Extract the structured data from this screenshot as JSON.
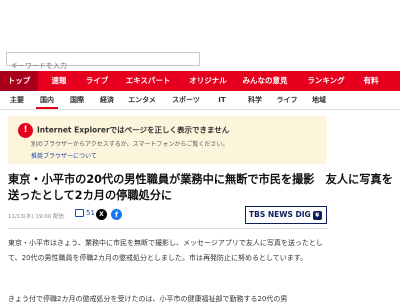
{
  "search": {
    "placeholder": "キーワードを入力"
  },
  "nav": {
    "items": [
      "トップ",
      "速報",
      "ライブ",
      "エキスパート",
      "オリジナル",
      "みんなの意見",
      "ランキング",
      "有料"
    ],
    "active": "トップ"
  },
  "subnav": {
    "items": [
      "主要",
      "国内",
      "国際",
      "経済",
      "エンタメ",
      "スポーツ",
      "IT",
      "科学",
      "ライフ",
      "地域"
    ],
    "active": "国内"
  },
  "notice": {
    "title": "Internet Explorerではページを正しく表示できません",
    "line1": "別のブラウザーからアクセスするか、スマートフォンからご覧ください。",
    "link": "推奨ブラウザーについて"
  },
  "article": {
    "headline": "東京・小平市の20代の男性職員が業務中に無断で市民を撮影　友人に写真を送ったとして2カ月の停職処分に",
    "date": "11/13(木) 19:00 配信",
    "comment_count": "51",
    "source_logo": "TBS NEWS DIG",
    "paragraph1": "東京・小平市はきょう、業務中に市民を無断で撮影し、メッセージアプリで友人に写真を送ったとして、20代の男性職員を停職2カ月の懲戒処分としました。市は再発防止に努めるとしています。",
    "paragraph2": "きょう付で停職2カ月の懲戒処分を受けたのは、小平市の健康福祉部で勤務する20代の男"
  },
  "colors": {
    "brand_red": "#e6001e",
    "link_blue": "#1a4ea8"
  }
}
